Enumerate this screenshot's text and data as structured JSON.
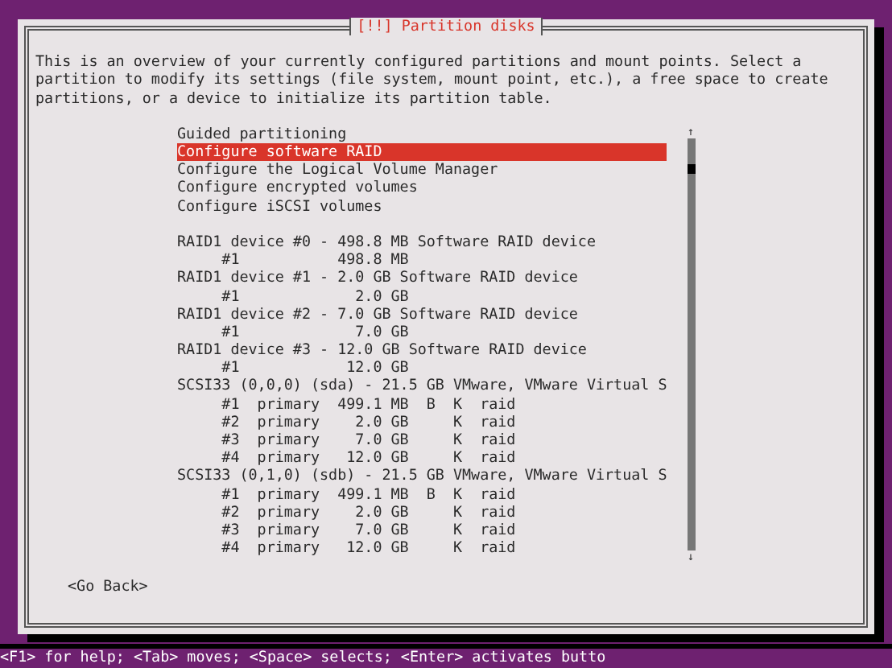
{
  "dialog": {
    "title": "[!!] Partition disks",
    "description": "This is an overview of your currently configured partitions and mount points. Select a\npartition to modify its settings (file system, mount point, etc.), a free space to create\npartitions, or a device to initialize its partition table."
  },
  "actions": [
    {
      "label": "Guided partitioning",
      "selected": false
    },
    {
      "label": "Configure software RAID",
      "selected": true
    },
    {
      "label": "Configure the Logical Volume Manager",
      "selected": false
    },
    {
      "label": "Configure encrypted volumes",
      "selected": false
    },
    {
      "label": "Configure iSCSI volumes",
      "selected": false
    }
  ],
  "devices": [
    {
      "label": "RAID1 device #0 - 498.8 MB Software RAID device",
      "selected": false
    },
    {
      "label": "     #1           498.8 MB",
      "selected": false
    },
    {
      "label": "RAID1 device #1 - 2.0 GB Software RAID device",
      "selected": false
    },
    {
      "label": "     #1             2.0 GB",
      "selected": false
    },
    {
      "label": "RAID1 device #2 - 7.0 GB Software RAID device",
      "selected": false
    },
    {
      "label": "     #1             7.0 GB",
      "selected": false
    },
    {
      "label": "RAID1 device #3 - 12.0 GB Software RAID device",
      "selected": false
    },
    {
      "label": "     #1            12.0 GB",
      "selected": false
    },
    {
      "label": "SCSI33 (0,0,0) (sda) - 21.5 GB VMware, VMware Virtual S",
      "selected": false
    },
    {
      "label": "     #1  primary  499.1 MB  B  K  raid",
      "selected": false
    },
    {
      "label": "     #2  primary    2.0 GB     K  raid",
      "selected": false
    },
    {
      "label": "     #3  primary    7.0 GB     K  raid",
      "selected": false
    },
    {
      "label": "     #4  primary   12.0 GB     K  raid",
      "selected": false
    },
    {
      "label": "SCSI33 (0,1,0) (sdb) - 21.5 GB VMware, VMware Virtual S",
      "selected": false
    },
    {
      "label": "     #1  primary  499.1 MB  B  K  raid",
      "selected": false
    },
    {
      "label": "     #2  primary    2.0 GB     K  raid",
      "selected": false
    },
    {
      "label": "     #3  primary    7.0 GB     K  raid",
      "selected": false
    },
    {
      "label": "     #4  primary   12.0 GB     K  raid",
      "selected": false
    }
  ],
  "scroll": {
    "up": "↑",
    "down": "↓"
  },
  "buttons": [
    "<Go Back>"
  ],
  "status_bar": "<F1> for help; <Tab> moves; <Space> selects; <Enter> activates butto"
}
